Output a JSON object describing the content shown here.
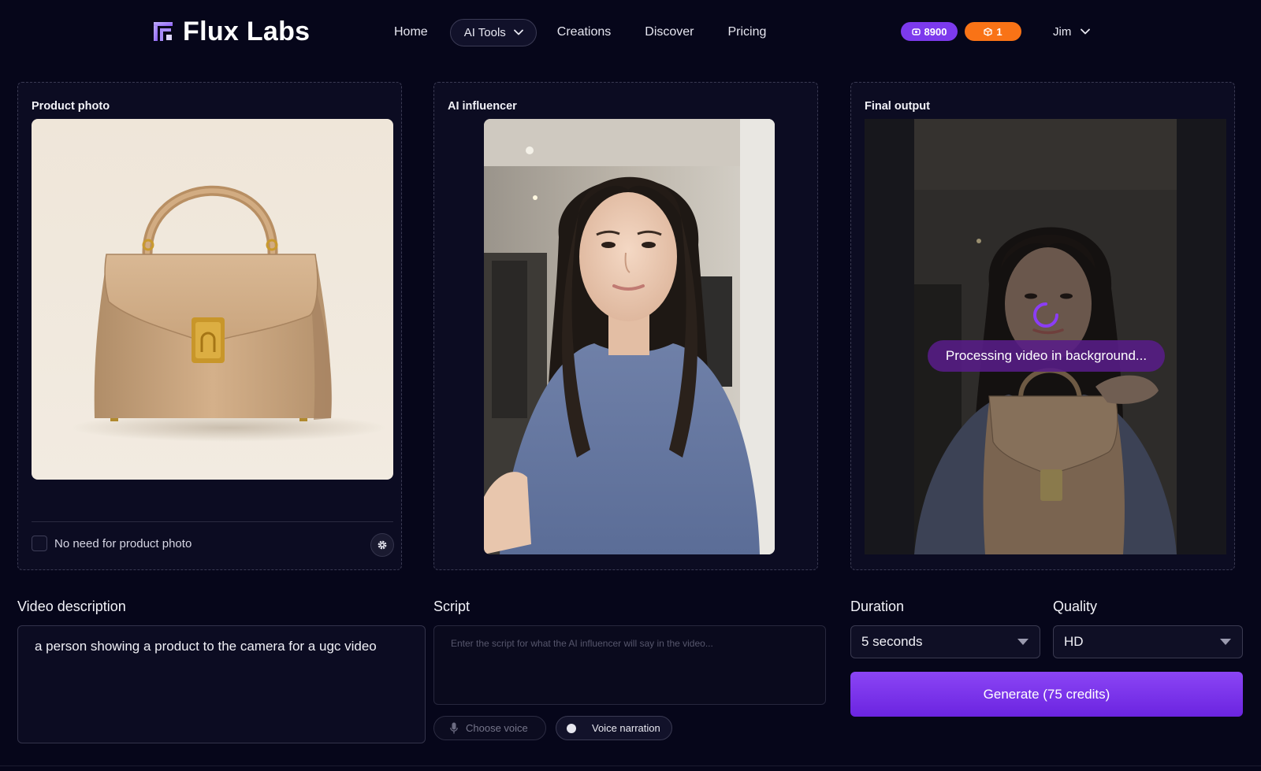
{
  "app": {
    "name": "Flux Labs"
  },
  "nav": {
    "home": "Home",
    "ai_tools": "AI Tools",
    "creations": "Creations",
    "discover": "Discover",
    "pricing": "Pricing"
  },
  "account": {
    "credits": "8900",
    "boxes": "1",
    "user_name": "Jim"
  },
  "panels": {
    "product": {
      "title": "Product photo",
      "no_photo_label": "No need for product photo",
      "no_photo_checked": false
    },
    "influencer": {
      "title": "AI influencer"
    },
    "output": {
      "title": "Final output",
      "status": "Processing video in background..."
    }
  },
  "form": {
    "video_description_label": "Video description",
    "video_description_value": "a person showing a product to the camera for a ugc video",
    "script_label": "Script",
    "script_placeholder": "Enter the script for what the AI influencer will say in the video...",
    "choose_voice": "Choose voice",
    "voice_narration": "Voice narration",
    "duration_label": "Duration",
    "duration_value": "5 seconds",
    "quality_label": "Quality",
    "quality_value": "HD",
    "generate_label": "Generate (75 credits)"
  },
  "colors": {
    "background": "#06061a",
    "accent": "#7c3aed",
    "accent_orange": "#f97316",
    "panel": "#0c0c22"
  }
}
